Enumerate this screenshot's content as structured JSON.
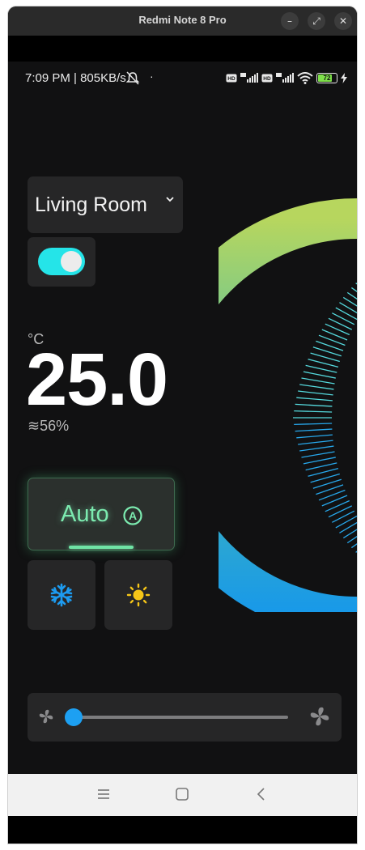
{
  "window": {
    "title": "Redmi Note 8 Pro",
    "buttons": [
      "–",
      "⤢",
      "✕"
    ]
  },
  "status_bar": {
    "left_text": "7:09 PM | 805KB/s",
    "battery_level": "72",
    "icons": [
      "mute-icon",
      "hd-icon",
      "signal-icon",
      "wifi-icon",
      "battery-icon",
      "charging-icon"
    ]
  },
  "room": {
    "label": "Living Room"
  },
  "power": {
    "on": true
  },
  "temperature": {
    "unit": "°C",
    "value": "25.0",
    "humidity": "≋56%"
  },
  "modes": {
    "auto_label": "Auto",
    "selected": "auto"
  },
  "fan": {
    "level": 0.0
  },
  "colors": {
    "accent_cyan": "#25e4e8",
    "accent_green": "#6fe3a5",
    "accent_blue": "#1da0f2",
    "sun_yellow": "#f5c518",
    "panel": "#262627"
  }
}
